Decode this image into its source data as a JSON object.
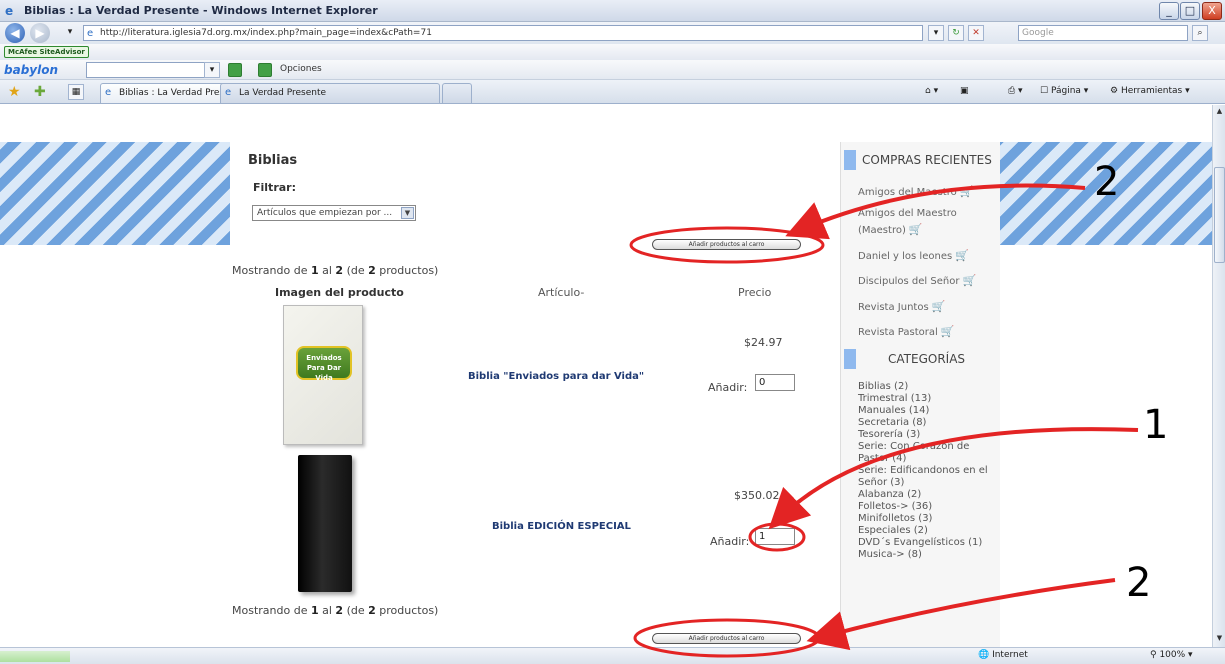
{
  "window": {
    "title": "Biblias : La Verdad Presente - Windows Internet Explorer",
    "min": "_",
    "max": "□",
    "close": "X"
  },
  "addressbar": {
    "url": "http://literatura.iglesia7d.org.mx/index.php?main_page=index&cPath=71",
    "search_placeholder": "Google"
  },
  "toolbars": {
    "mcafee_label": "McAfee SiteAdvisor",
    "babylon_logo": "babylon",
    "options_label": "Opciones"
  },
  "tabs": [
    {
      "label": "Biblias : La Verdad Presente"
    },
    {
      "label": "La Verdad Presente"
    }
  ],
  "commandbar": {
    "page_label": "Página",
    "tools_label": "Herramientas"
  },
  "content": {
    "heading": "Biblias",
    "filter_label": "Filtrar:",
    "filter_value": "Artículos que empiezan por ...",
    "add_to_cart_label": "Añadir productos al carro",
    "showing_prefix": "Mostrando de",
    "showing_from": "1",
    "showing_mid": "al",
    "showing_to": "2",
    "showing_total_prefix": "(de",
    "showing_total": "2",
    "showing_suffix": "productos)",
    "col_image": "Imagen del producto",
    "col_article": "Artículo-",
    "col_price": "Precio",
    "products": [
      {
        "name": "Biblia \"Enviados para dar Vida\"",
        "price": "$24.97",
        "add_label": "Añadir:",
        "qty": "0",
        "image_text": "Enviados Para Dar Vida"
      },
      {
        "name": "Biblia EDICIÓN ESPECIAL",
        "price": "$350.02",
        "add_label": "Añadir:",
        "qty": "1"
      }
    ]
  },
  "sidebar": {
    "recent_title": "COMPRAS RECIENTES",
    "recent": [
      "Amigos del Maestro",
      "Amigos del Maestro (Maestro)",
      "Daniel y los leones",
      "Discipulos del Señor",
      "Revista Juntos",
      "Revista Pastoral"
    ],
    "categories_title": "CATEGORÍAS",
    "categories": [
      "Biblias (2)",
      "Trimestral (13)",
      "Manuales (14)",
      "Secretaria (8)",
      "Tesorería (3)",
      "Serie: Con Corazón de Pastor (4)",
      "Serie: Edificandonos en el Señor (3)",
      "Alabanza (2)",
      "Folletos-> (36)",
      "Minifolletos (3)",
      "Especiales (2)",
      "DVD´s Evangelísticos (1)",
      "Musica-> (8)"
    ]
  },
  "statusbar": {
    "zone": "Internet",
    "zoom": "100%"
  },
  "annotations": {
    "label_1": "1",
    "label_2a": "2",
    "label_2b": "2",
    "color": "#e32424"
  }
}
